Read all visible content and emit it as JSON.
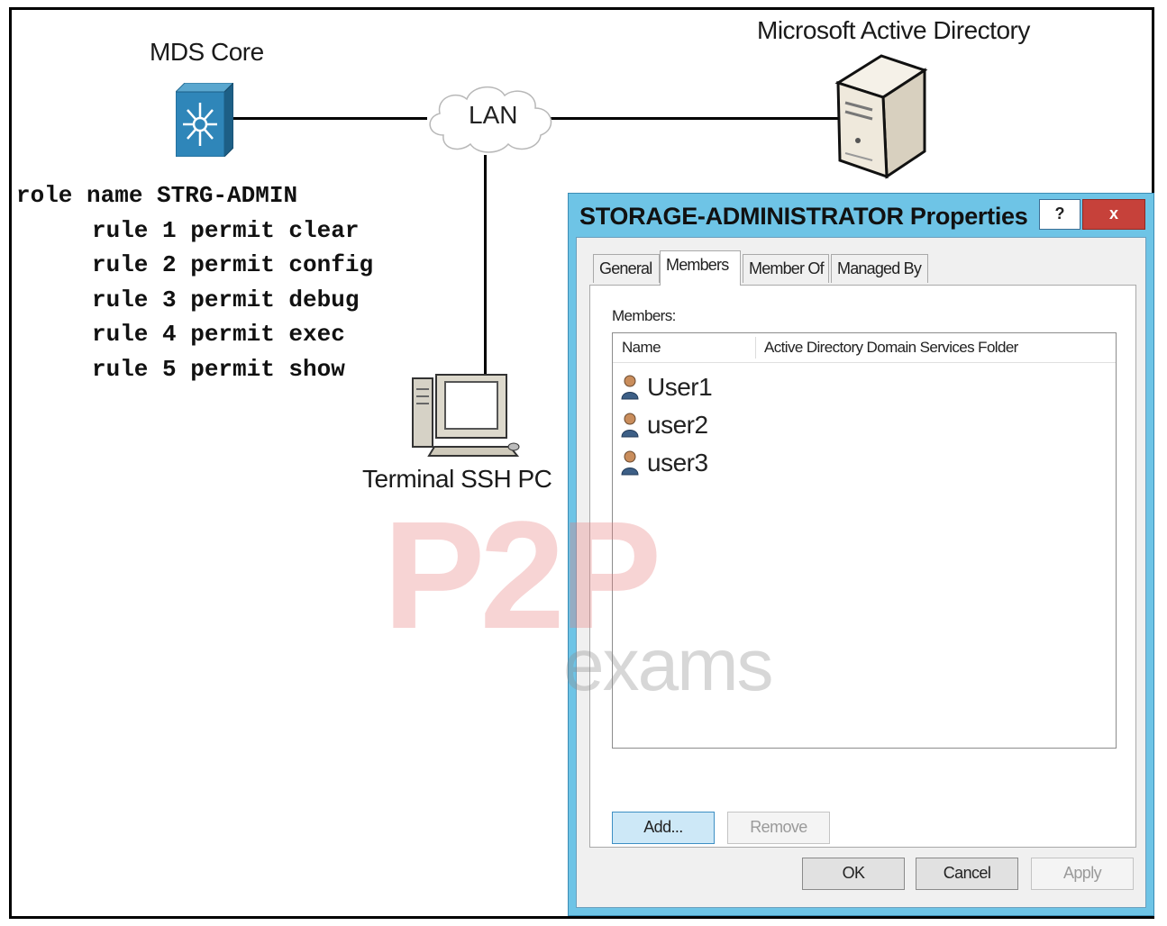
{
  "diagram": {
    "mds_label": "MDS Core",
    "lan_label": "LAN",
    "ad_label": "Microsoft Active Directory",
    "pc_label": "Terminal SSH PC"
  },
  "code": {
    "role_line": "role name STRG-ADMIN",
    "rules": [
      "rule 1 permit clear",
      "rule 2 permit config",
      "rule 3 permit debug",
      "rule 4 permit exec",
      "rule 5 permit show"
    ]
  },
  "watermark": {
    "brand": "P2P",
    "sub": "exams"
  },
  "dialog": {
    "title": "STORAGE-ADMINISTRATOR Properties",
    "help_label": "?",
    "close_label": "x",
    "tabs": [
      {
        "label": "General",
        "active": false
      },
      {
        "label": "Members",
        "active": true
      },
      {
        "label": "Member Of",
        "active": false
      },
      {
        "label": "Managed By",
        "active": false
      }
    ],
    "members_label": "Members:",
    "columns": [
      "Name",
      "Active Directory Domain Services Folder"
    ],
    "members": [
      {
        "name": "User1",
        "folder": ""
      },
      {
        "name": "user2",
        "folder": ""
      },
      {
        "name": "user3",
        "folder": ""
      }
    ],
    "add_label": "Add...",
    "remove_label": "Remove",
    "ok_label": "OK",
    "cancel_label": "Cancel",
    "apply_label": "Apply"
  }
}
